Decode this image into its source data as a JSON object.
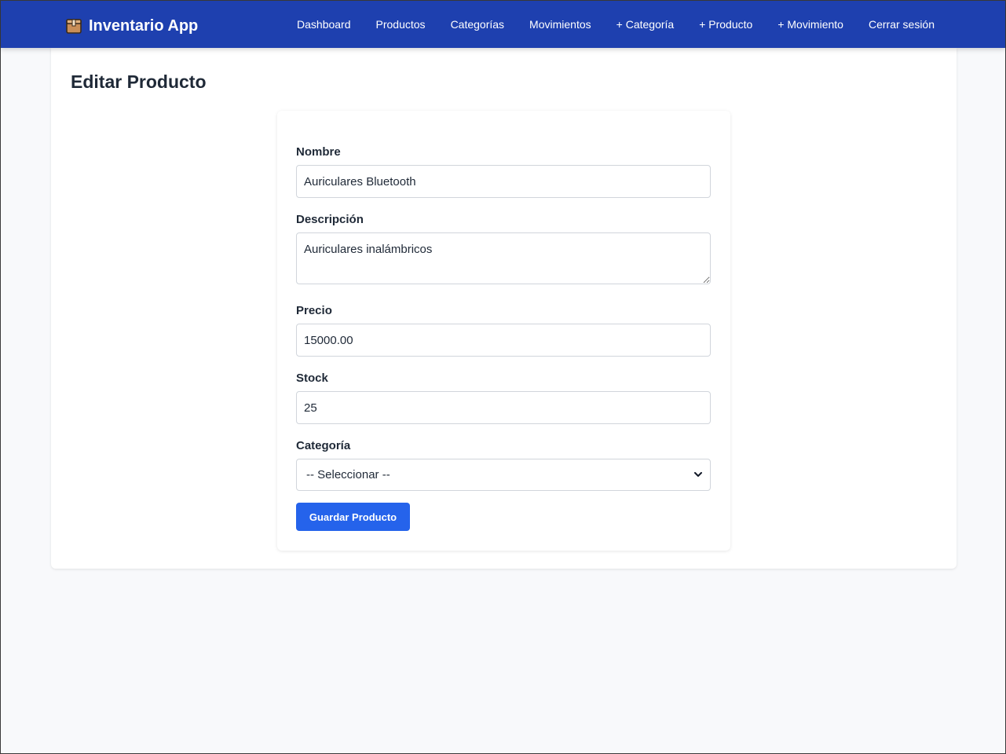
{
  "navbar": {
    "brand": "Inventario App",
    "brand_icon": "package-box-icon",
    "bg_color": "#1e40af",
    "links": [
      "Dashboard",
      "Productos",
      "Categorías",
      "Movimientos",
      "+ Categoría",
      "+ Producto",
      "+ Movimiento",
      "Cerrar sesión"
    ]
  },
  "page": {
    "title": "Editar Producto"
  },
  "form": {
    "nombre_label": "Nombre",
    "nombre_value": "Auriculares Bluetooth",
    "descripcion_label": "Descripción",
    "descripcion_value": "Auriculares inalámbricos",
    "precio_label": "Precio",
    "precio_value": "15000.00",
    "stock_label": "Stock",
    "stock_value": "25",
    "categoria_label": "Categoría",
    "categoria_selected": "-- Seleccionar --",
    "submit_label": "Guardar Producto",
    "submit_color": "#2563eb"
  }
}
